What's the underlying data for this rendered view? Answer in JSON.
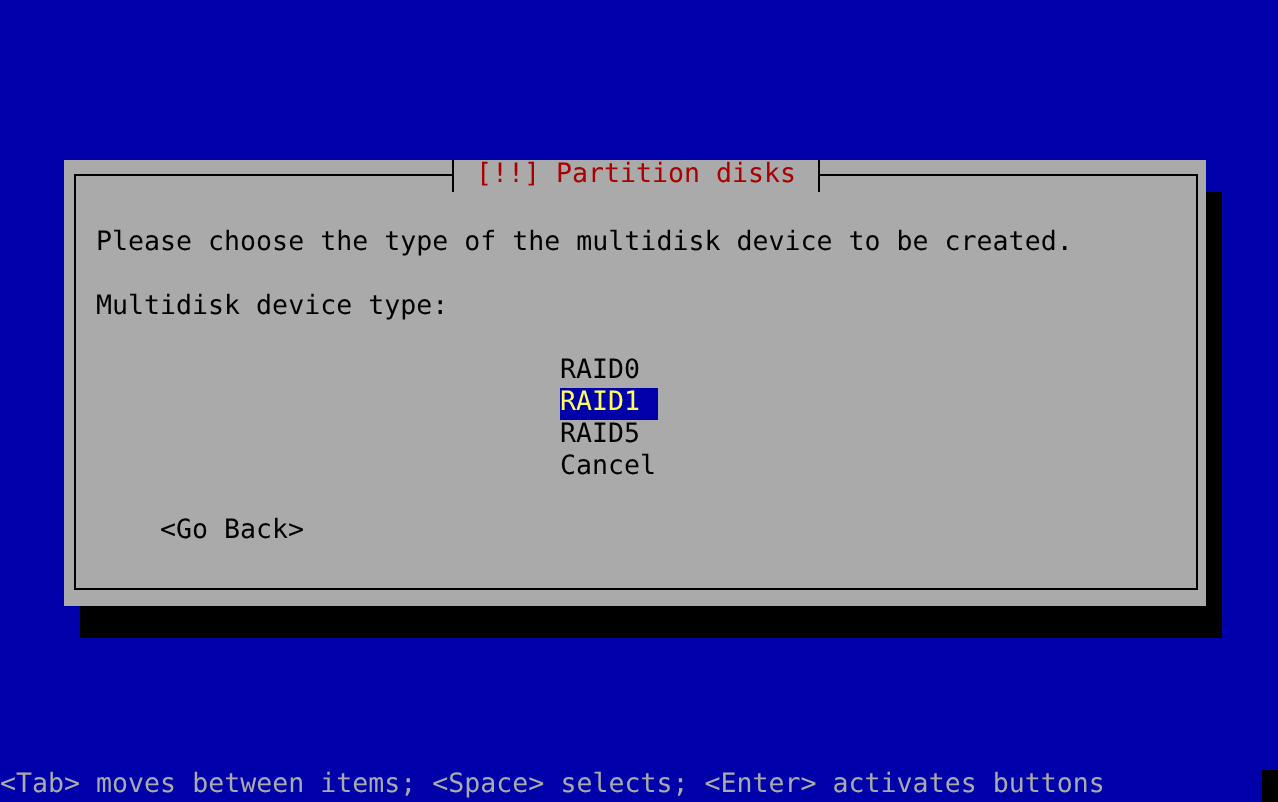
{
  "dialog": {
    "title": "[!!] Partition disks",
    "prompt": "Please choose the type of the multidisk device to be created.",
    "list_label": "Multidisk device type:",
    "options": [
      {
        "label": "RAID0",
        "selected": false
      },
      {
        "label": "RAID1",
        "selected": true
      },
      {
        "label": "RAID5",
        "selected": false
      },
      {
        "label": "Cancel",
        "selected": false
      }
    ],
    "back_button": "<Go Back>"
  },
  "status_bar": "<Tab> moves between items; <Space> selects; <Enter> activates buttons"
}
